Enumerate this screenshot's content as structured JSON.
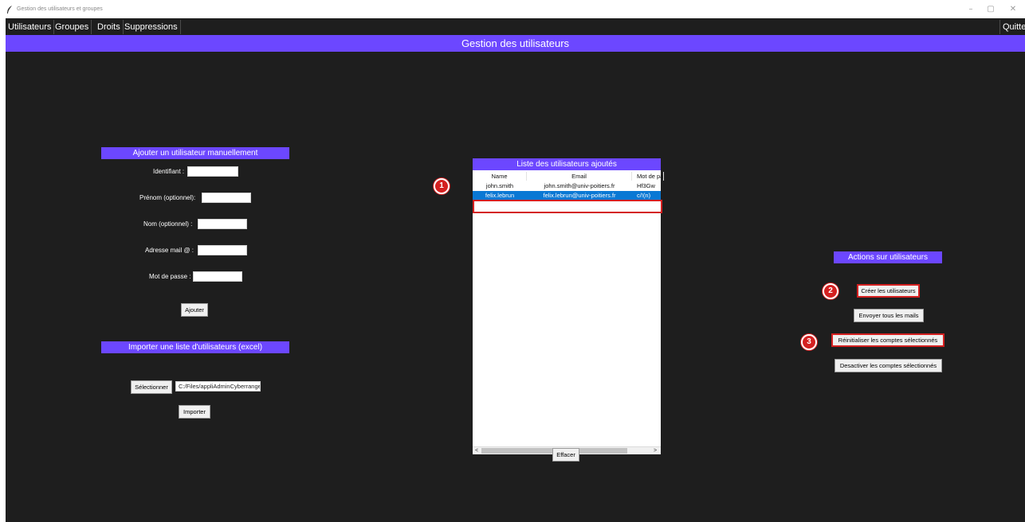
{
  "window": {
    "title": "Gestion des utilisateurs et groupes",
    "minimize_glyph": "–",
    "maximize_glyph": "▢",
    "close_glyph": "✕",
    "app_icon": "feather-icon"
  },
  "menu": {
    "items": [
      "Utilisateurs",
      "Groupes",
      "Droits",
      "Suppressions"
    ],
    "quit": "Quitter"
  },
  "banner": {
    "title": "Gestion des utilisateurs"
  },
  "manual_add": {
    "header": "Ajouter un utilisateur manuellement",
    "fields": {
      "identifiant": "Identifiant :",
      "prenom": "Prénom (optionnel):",
      "nom": "Nom (optionnel) :",
      "email": "Adresse mail @ :",
      "password": "Mot de passe :"
    },
    "add_button": "Ajouter"
  },
  "import": {
    "header": "Importer une liste d'utilisateurs (excel)",
    "select_button": "Sélectionner",
    "file_path": "C:/Files/appliAdminCyberrange",
    "import_button": "Importer"
  },
  "user_list": {
    "header": "Liste des utilisateurs ajoutés",
    "columns": [
      "Name",
      "Email",
      "Mot de passe"
    ],
    "rows": [
      {
        "name": "john.smith",
        "email": "john.smith@univ-poitiers.fr",
        "password": "Hf3Gw"
      },
      {
        "name": "felix.lebrun",
        "email": "felix.lebrun@univ-poitiers.fr",
        "password": "c/!(n)"
      }
    ],
    "selected_index": 1,
    "scroll_left": "<",
    "scroll_right": ">",
    "clear_button": "Effacer"
  },
  "actions": {
    "header": "Actions sur utilisateurs",
    "create": "Créer les utilisateurs",
    "send_mails": "Envoyer tous les mails",
    "reset": "Réinitialiser les comptes sélectionnés",
    "deactivate": "Desactiver les comptes sélectionnés"
  },
  "annotations": [
    "1",
    "2",
    "3"
  ],
  "colors": {
    "accent": "#6c47ff",
    "background": "#1e1e1e",
    "selection": "#0a78d4",
    "highlight": "#d42020"
  }
}
